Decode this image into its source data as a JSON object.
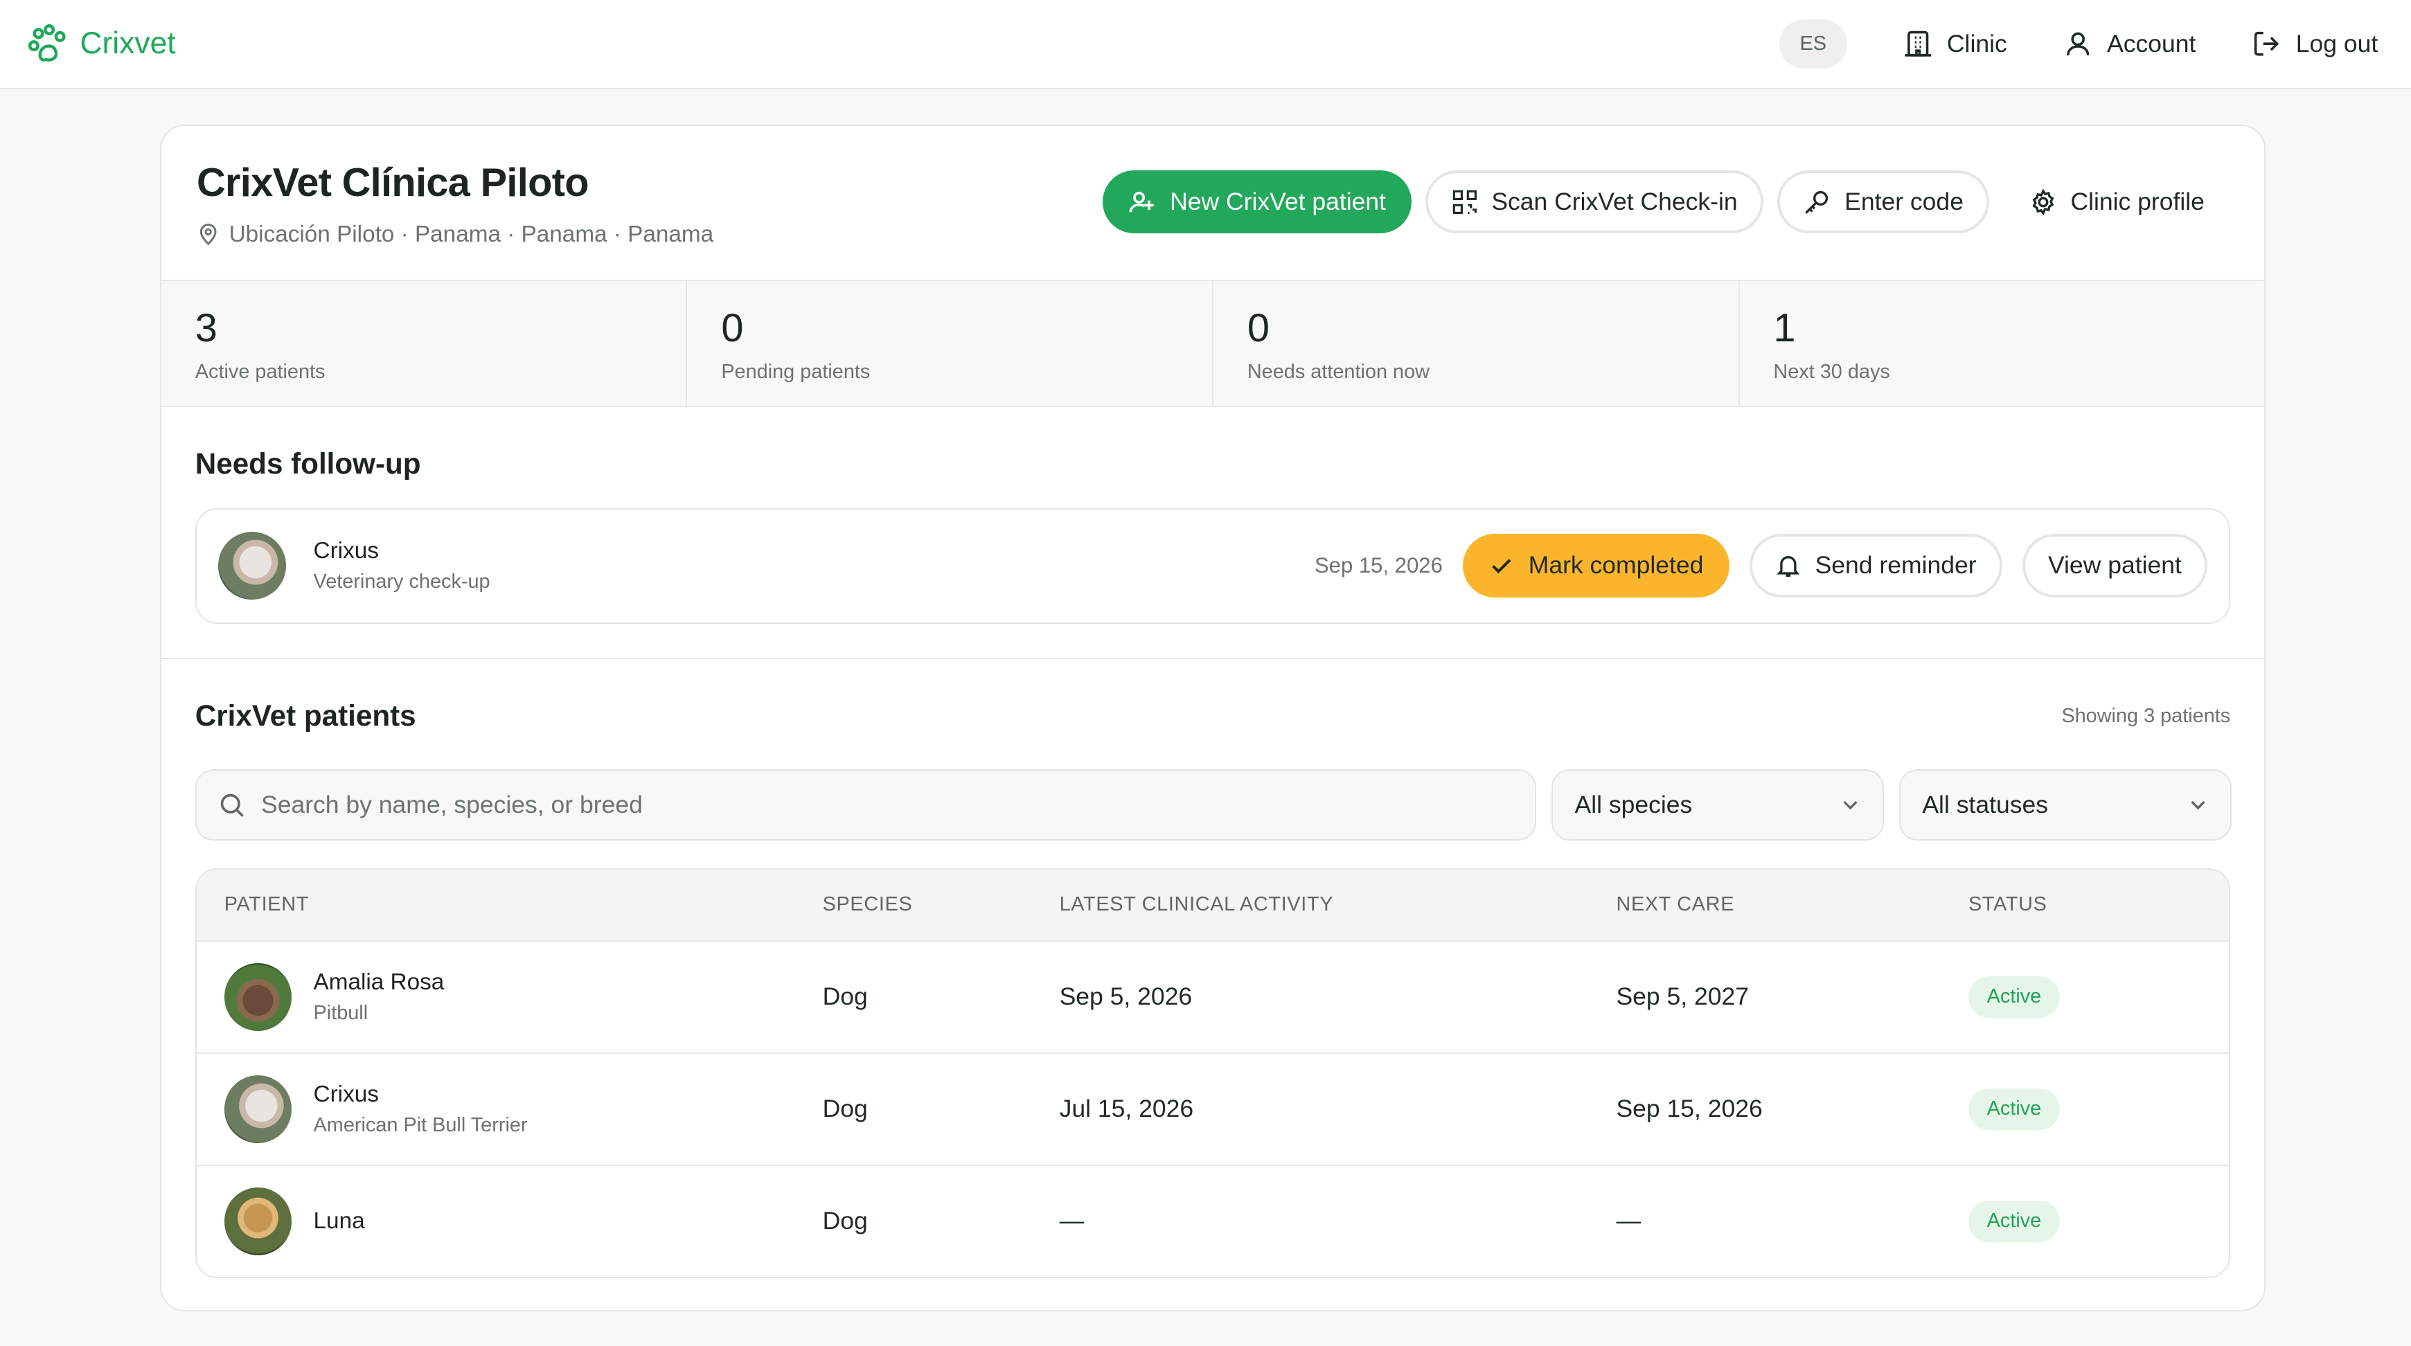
{
  "app": {
    "name": "Crixvet",
    "brand_color": "#1fa85a"
  },
  "nav": {
    "lang": "ES",
    "clinic": "Clinic",
    "account": "Account",
    "logout": "Log out"
  },
  "clinic": {
    "title": "CrixVet Clínica Piloto",
    "location": "Ubicación Piloto · Panama · Panama · Panama"
  },
  "actions": {
    "new_patient": "New CrixVet patient",
    "scan_checkin": "Scan CrixVet Check-in",
    "enter_code": "Enter code",
    "clinic_profile": "Clinic profile"
  },
  "stats": [
    {
      "value": "3",
      "label": "Active patients"
    },
    {
      "value": "0",
      "label": "Pending patients"
    },
    {
      "value": "0",
      "label": "Needs attention now"
    },
    {
      "value": "1",
      "label": "Next 30 days"
    }
  ],
  "followup": {
    "title": "Needs follow-up",
    "item": {
      "name": "Crixus",
      "subtitle": "Veterinary check-up",
      "date": "Sep 15, 2026",
      "mark_completed": "Mark completed",
      "send_reminder": "Send reminder",
      "view_patient": "View patient"
    }
  },
  "patients": {
    "title": "CrixVet patients",
    "showing": "Showing 3 patients",
    "search_placeholder": "Search by name, species, or breed",
    "species_filter": "All species",
    "status_filter": "All statuses",
    "columns": [
      "PATIENT",
      "SPECIES",
      "LATEST CLINICAL ACTIVITY",
      "NEXT CARE",
      "STATUS"
    ],
    "rows": [
      {
        "name": "Amalia Rosa",
        "breed": "Pitbull",
        "species": "Dog",
        "latest": "Sep 5, 2026",
        "next": "Sep 5, 2027",
        "status": "Active"
      },
      {
        "name": "Crixus",
        "breed": "American Pit Bull Terrier",
        "species": "Dog",
        "latest": "Jul 15, 2026",
        "next": "Sep 15, 2026",
        "status": "Active"
      },
      {
        "name": "Luna",
        "breed": "",
        "species": "Dog",
        "latest": "—",
        "next": "—",
        "status": "Active"
      }
    ]
  }
}
